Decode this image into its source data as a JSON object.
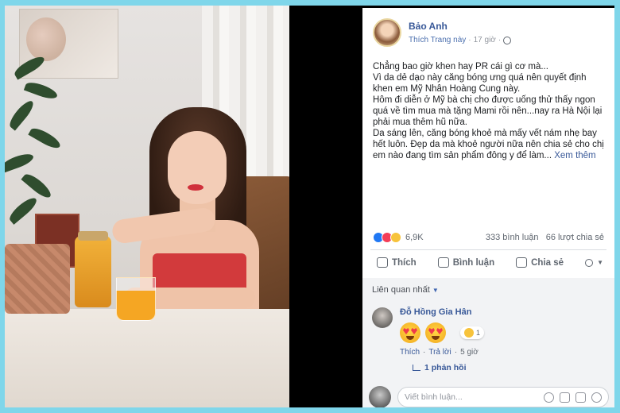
{
  "post": {
    "author": "Bảo Anh",
    "like_page": "Thích Trang này",
    "time": "17 giờ",
    "body": "Chẳng bao giờ khen hay PR cái gì cơ mà...\nVì da dẻ dạo này căng bóng ưng quá nên quyết định khen em Mỹ Nhân Hoàng Cung này.\nHôm đi diễn ở Mỹ bà chị cho được uống thử thấy ngon quá về tìm mua mà tặng Mami rồi nên...nay ra Hà Nội lại phải mua thêm hũ nữa.\nDa sáng lên, căng bóng khoẻ mà mấy vết nám nhẹ bay hết luôn. Đẹp da mà khoẻ người nữa nên chia sẻ cho chị em nào đang tìm sản phẩm đông y để làm...",
    "see_more": "Xem thêm",
    "reaction_count": "6,9K",
    "comment_count": "333 bình luận",
    "share_count": "66 lượt chia sẻ"
  },
  "actions": {
    "like": "Thích",
    "comment": "Bình luận",
    "share": "Chia sẻ"
  },
  "comments": {
    "filter": "Liên quan nhất",
    "items": [
      {
        "author": "Đỗ Hồng Gia Hân",
        "reaction_count": "1",
        "like": "Thích",
        "reply": "Trả lời",
        "time": "5 giờ"
      }
    ],
    "replies_label": "1 phản hồi",
    "write_placeholder": "Viết bình luận..."
  },
  "colors": {
    "background": "#7fd6ea",
    "link": "#385898",
    "like_blue": "#2078f4"
  },
  "icons": [
    "globe-icon",
    "like-icon",
    "comment-icon",
    "share-icon",
    "emoji-icon",
    "camera-icon",
    "gif-icon",
    "sticker-icon"
  ]
}
